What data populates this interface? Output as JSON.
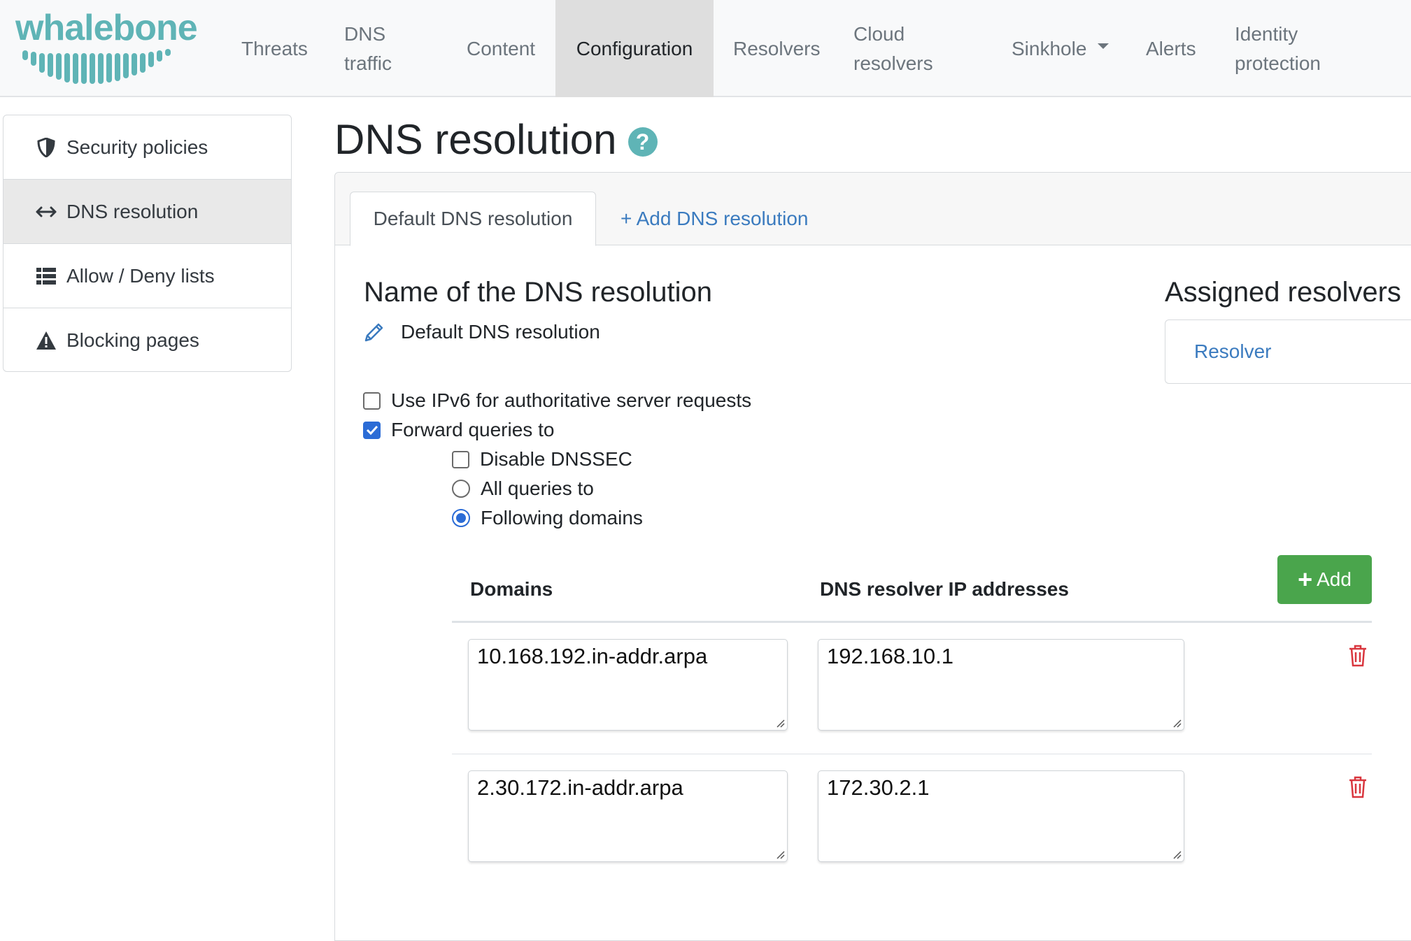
{
  "brand": {
    "logo_text": "whalebone",
    "color": "#5fb4b6"
  },
  "nav": {
    "items": [
      {
        "label": "Threats"
      },
      {
        "label": "DNS",
        "label2": "traffic"
      },
      {
        "label": "Content"
      },
      {
        "label": "Configuration",
        "active": true
      },
      {
        "label": "Resolvers"
      },
      {
        "label": "Cloud",
        "label2": "resolvers"
      },
      {
        "label": "Sinkhole",
        "dropdown": true
      },
      {
        "label": "Alerts"
      },
      {
        "label": "Identity",
        "label2": "protection"
      }
    ]
  },
  "sidebar": {
    "items": [
      {
        "label": "Security policies",
        "icon": "shield-icon"
      },
      {
        "label": "DNS resolution",
        "icon": "arrows-horizontal-icon",
        "active": true
      },
      {
        "label": "Allow / Deny lists",
        "icon": "list-icon"
      },
      {
        "label": "Blocking pages",
        "icon": "warning-icon"
      }
    ]
  },
  "page": {
    "title": "DNS resolution",
    "help_icon": "?"
  },
  "tabs": {
    "active_label": "Default DNS resolution",
    "add_label": "+ Add DNS resolution"
  },
  "form": {
    "name_heading": "Name of the DNS resolution",
    "name_value": "Default DNS resolution",
    "ipv6_label": "Use IPv6 for authoritative server requests",
    "ipv6_checked": false,
    "forward_label": "Forward queries to",
    "forward_checked": true,
    "disable_dnssec_label": "Disable DNSSEC",
    "disable_dnssec_checked": false,
    "all_queries_label": "All queries to",
    "following_domains_label": "Following domains",
    "selected_mode": "following_domains"
  },
  "assigned": {
    "heading": "Assigned resolvers",
    "resolver_label": "Resolver"
  },
  "table": {
    "col_domains": "Domains",
    "col_ips": "DNS resolver IP addresses",
    "add_label": "Add",
    "rows": [
      {
        "domains": "10.168.192.in-addr.arpa",
        "ips": "192.168.10.1"
      },
      {
        "domains": "2.30.172.in-addr.arpa",
        "ips": "172.30.2.1"
      }
    ]
  },
  "colors": {
    "accent": "#5fb4b6",
    "link": "#3b7bbf",
    "success": "#4aa54c",
    "danger": "#d9363e",
    "checkbox": "#2b6cd6"
  }
}
